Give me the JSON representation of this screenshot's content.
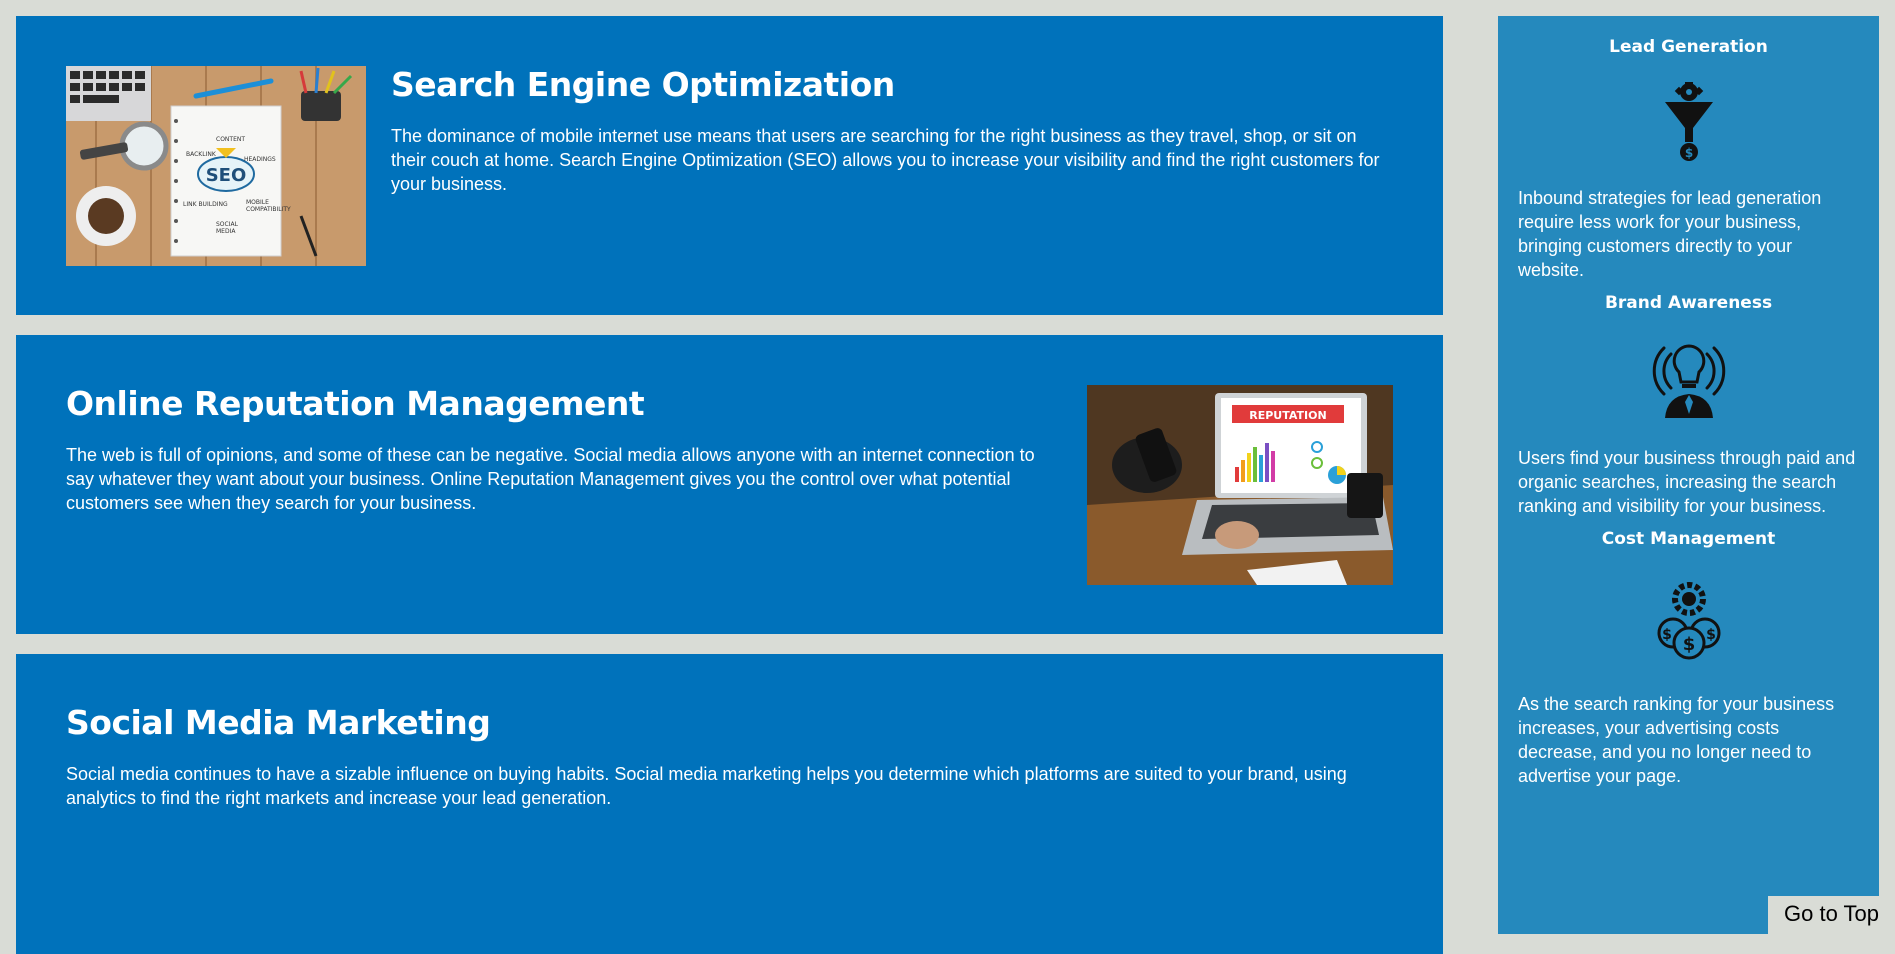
{
  "services": [
    {
      "title": "Search Engine Optimization",
      "text": "The dominance of mobile internet use means that users are searching for the right business as they travel, shop, or sit on their couch at home. Search Engine Optimization (SEO) allows you to increase your visibility and find the right customers for your business.",
      "image": "seo-notebook-desk-image"
    },
    {
      "title": "Online Reputation Management",
      "text": "The web is full of opinions, and some of these can be negative. Social media allows anyone with an internet connection to say whatever they want about your business. Online Reputation Management gives you the control over what potential customers see when they search for your business.",
      "image": "reputation-laptop-image",
      "image_text": "REPUTATION"
    },
    {
      "title": "Social Media Marketing",
      "text": "Social media continues to have a sizable influence on buying habits. Social media marketing helps you determine which platforms are suited to your brand, using analytics to find the right markets and increase your lead generation."
    }
  ],
  "benefits": [
    {
      "title": "Lead Generation",
      "icon": "lead-generation-funnel-icon",
      "text": "Inbound strategies for lead generation require less work for your business, bringing customers directly to your website."
    },
    {
      "title": "Brand Awareness",
      "icon": "brand-awareness-lightbulb-icon",
      "text": "Users find your business through paid and organic searches, increasing the search ranking and visibility for your business."
    },
    {
      "title": "Cost Management",
      "icon": "cost-management-coins-icon",
      "text": "As the search ranking for your business increases, your advertising costs decrease, and you no longer need to advertise your page."
    }
  ],
  "go_to_top": "Go to Top",
  "colors": {
    "page_background": "#d9dcd6",
    "service_background": "#0072bb",
    "benefits_background": "#2589bd",
    "text": "#ffffff"
  }
}
